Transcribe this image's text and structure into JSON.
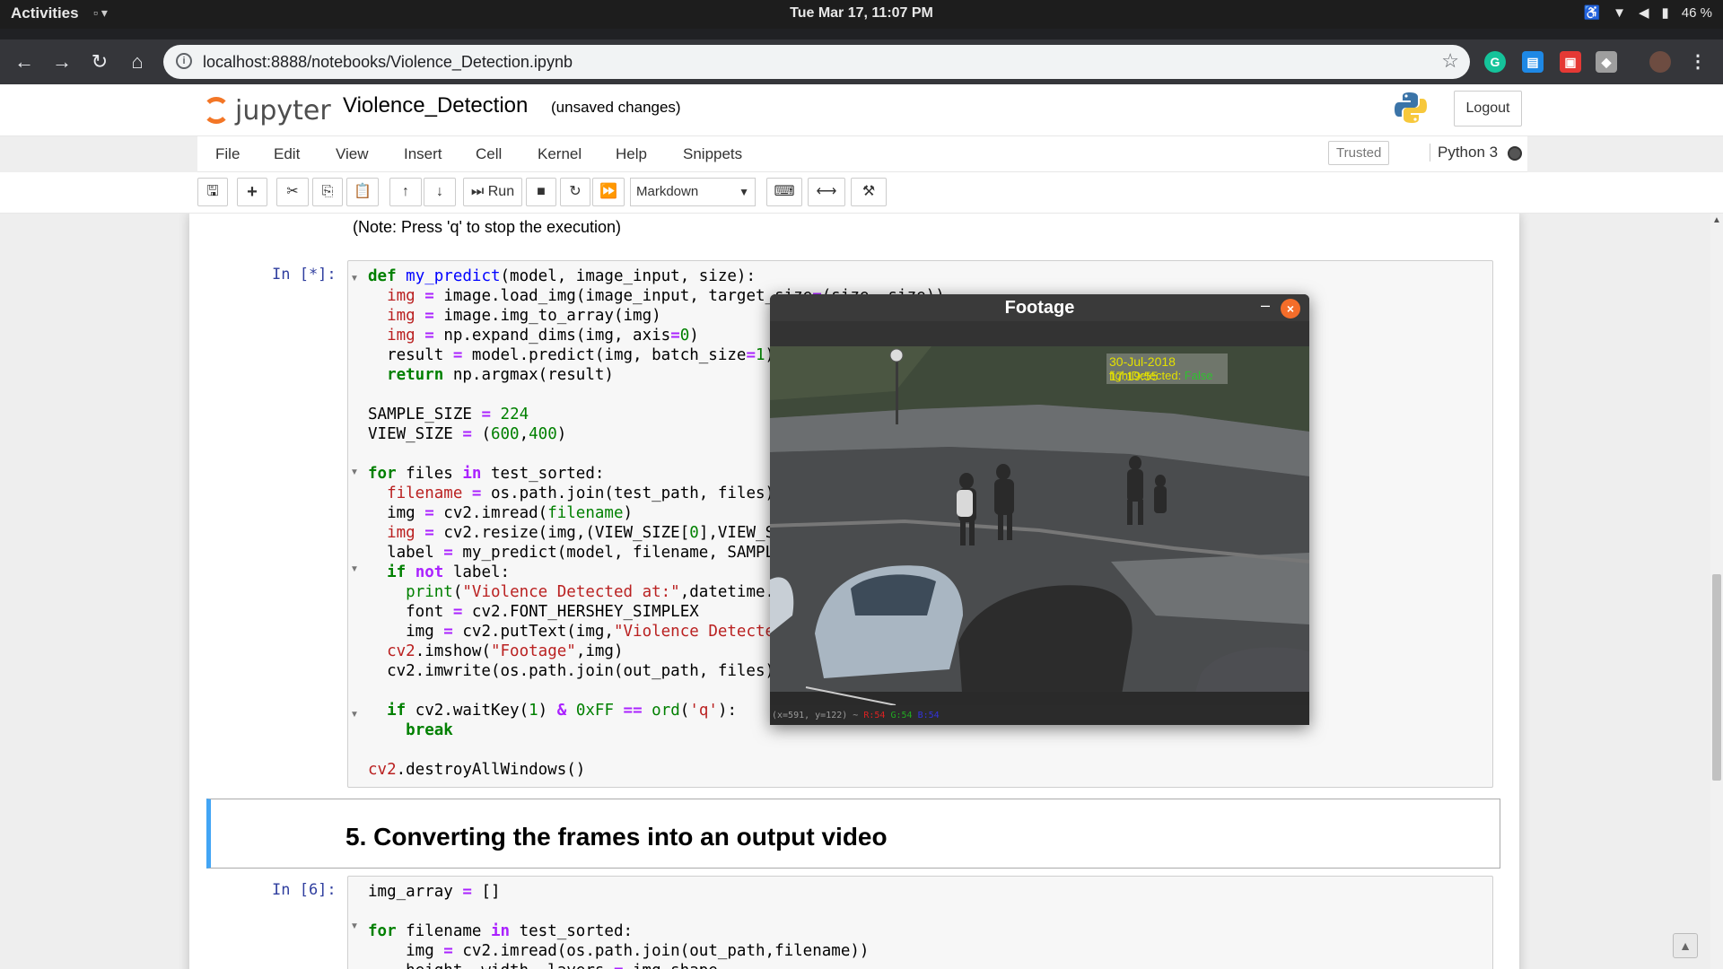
{
  "topbar": {
    "activities": "Activities",
    "clock": "Tue Mar 17, 11:07 PM",
    "battery": "46 %"
  },
  "browser": {
    "url": "localhost:8888/notebooks/Violence_Detection.ipynb"
  },
  "jupyter": {
    "logo_text": "jupyter",
    "notebook_name": "Violence_Detection",
    "save_status": "(unsaved changes)",
    "logout_label": "Logout",
    "menu": [
      "File",
      "Edit",
      "View",
      "Insert",
      "Cell",
      "Kernel",
      "Help",
      "Snippets"
    ],
    "trusted_label": "Trusted",
    "kernel_name": "Python 3",
    "run_label": "Run",
    "cell_type": "Markdown"
  },
  "notebook": {
    "note_text": "(Note: Press 'q' to stop the execution)",
    "cell1_prompt": "In [*]:",
    "markdown_heading": "5. Converting the frames into an output video",
    "cell2_prompt": "In [6]:"
  },
  "footage_window": {
    "title": "Footage",
    "timestamp": "30-Jul-2018 17:19:55",
    "fight_label": "fightDetected:",
    "fight_value": "False",
    "status_prefix": "(x=591, y=122) ~",
    "status_r": "R:54",
    "status_g": "G:54",
    "status_b": "B:54"
  }
}
